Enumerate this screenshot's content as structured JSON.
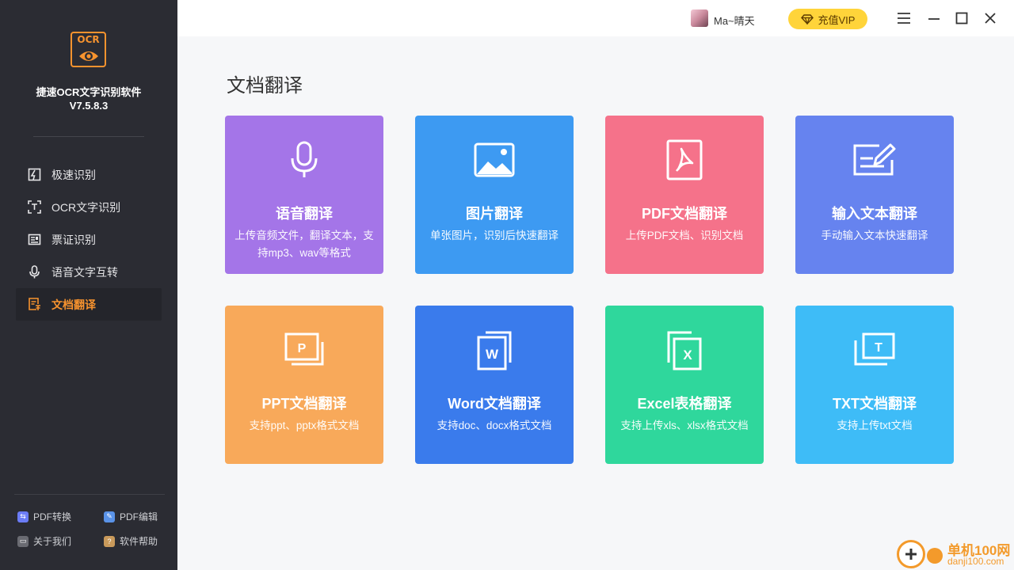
{
  "app": {
    "logo_text": "OCR",
    "name": "捷速OCR文字识别软件",
    "version": "V7.5.8.3"
  },
  "sidebar": {
    "items": [
      {
        "label": "极速识别",
        "icon": "fast-recognize-icon",
        "active": false
      },
      {
        "label": "OCR文字识别",
        "icon": "ocr-scan-icon",
        "active": false
      },
      {
        "label": "票证识别",
        "icon": "ticket-icon",
        "active": false
      },
      {
        "label": "语音文字互转",
        "icon": "microphone-icon",
        "active": false
      },
      {
        "label": "文档翻译",
        "icon": "document-translate-icon",
        "active": true
      }
    ],
    "bottom_links": [
      {
        "label": "PDF转换",
        "icon": "pdf-convert-icon",
        "color": "#6b7cf6"
      },
      {
        "label": "PDF编辑",
        "icon": "pdf-edit-icon",
        "color": "#5a93e8"
      },
      {
        "label": "关于我们",
        "icon": "about-icon",
        "color": "#6a6b72"
      },
      {
        "label": "软件帮助",
        "icon": "help-icon",
        "color": "#c99a5b"
      }
    ]
  },
  "topbar": {
    "username": "Ma~晴天",
    "vip_label": "充值VIP"
  },
  "main": {
    "title": "文档翻译",
    "cards": [
      {
        "title": "语音翻译",
        "desc": "上传音频文件，翻译文本，支持mp3、wav等格式",
        "icon": "microphone-icon",
        "color": "#a475e8"
      },
      {
        "title": "图片翻译",
        "desc": "单张图片，识别后快速翻译",
        "icon": "image-icon",
        "color": "#3d9af2"
      },
      {
        "title": "PDF文档翻译",
        "desc": "上传PDF文档、识别文档",
        "icon": "pdf-icon",
        "color": "#f5728a"
      },
      {
        "title": "输入文本翻译",
        "desc": "手动输入文本快速翻译",
        "icon": "text-edit-icon",
        "color": "#6683ef"
      },
      {
        "title": "PPT文档翻译",
        "desc": "支持ppt、pptx格式文档",
        "icon": "ppt-icon",
        "color": "#f8a95a"
      },
      {
        "title": "Word文档翻译",
        "desc": "支持doc、docx格式文档",
        "icon": "word-icon",
        "color": "#3a7bec"
      },
      {
        "title": "Excel表格翻译",
        "desc": "支持上传xls、xlsx格式文档",
        "icon": "excel-icon",
        "color": "#2fd79c"
      },
      {
        "title": "TXT文档翻译",
        "desc": "支持上传txt文档",
        "icon": "txt-icon",
        "color": "#3ebcf7"
      }
    ]
  },
  "watermark": {
    "line1": "单机100网",
    "line2": "danji100.com"
  }
}
